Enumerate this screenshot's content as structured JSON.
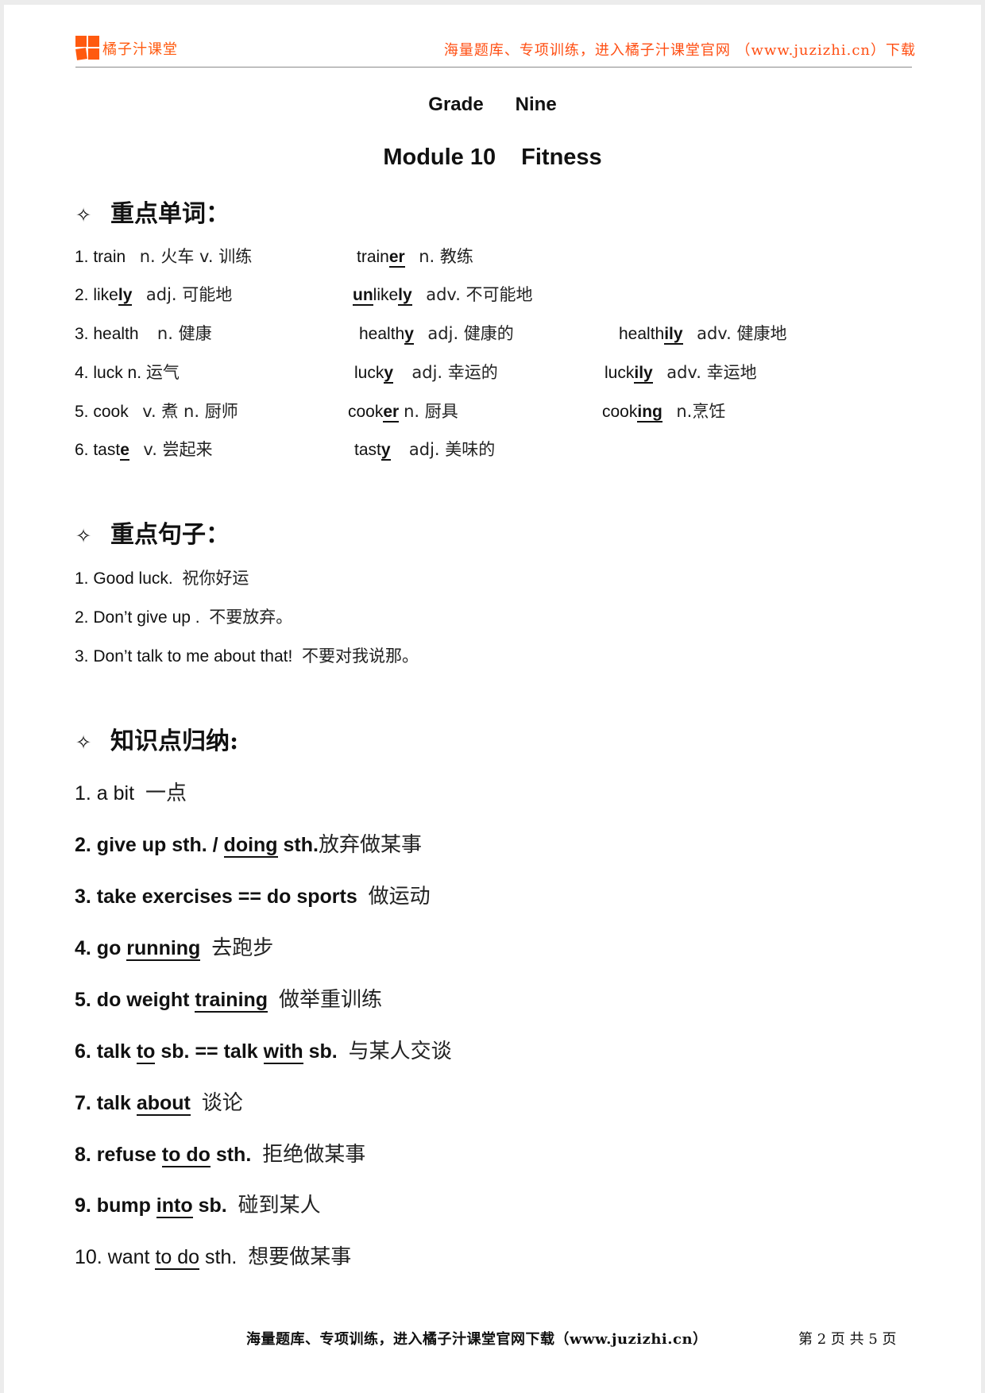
{
  "header": {
    "brand": "橘子汁课堂",
    "slogan": "海量题库、专项训练，进入橘子汁课堂官网 （www.juzizhi.cn）下载",
    "accent_color": "#ff5a0f"
  },
  "title": {
    "grade_label": "Grade",
    "grade_value": "Nine",
    "module": "Module 10",
    "topic": "Fitness"
  },
  "sections": {
    "vocab": {
      "heading": "重点单词：",
      "icon": "diamond-bullet-icon",
      "rows": [
        {
          "c1_pre": "1. train",
          "c1_ul": "",
          "c1_post": "",
          "c1_def": "n.  火车      v.  训练",
          "c2_pre": "train",
          "c2_ul": "er",
          "c2_post": "",
          "c2_def": "n.  教练",
          "c3_pre": "",
          "c3_ul": "",
          "c3_def": ""
        },
        {
          "c1_pre": "2. like",
          "c1_ul": "ly",
          "c1_post": "",
          "c1_def": "adj.  可能地",
          "c2_pre": "",
          "c2_ul": "un",
          "c2_mid": "like",
          "c2_ul2": "ly",
          "c2_def": "adv.  不可能地",
          "c3_pre": "",
          "c3_ul": "",
          "c3_def": ""
        },
        {
          "c1_pre": "3. health",
          "c1_ul": "",
          "c1_post": "",
          "c1_def": "n.  健康",
          "c2_pre": "health",
          "c2_ul": "y",
          "c2_post": "",
          "c2_def": "adj.  健康的",
          "c3_pre": "health",
          "c3_ul": "ily",
          "c3_def": "adv.    健康地"
        },
        {
          "c1_pre": "4. luck n.",
          "c1_ul": "",
          "c1_post": "",
          "c1_def": "运气",
          "c2_pre": "luck",
          "c2_ul": "y",
          "c2_post": "",
          "c2_def": "adj.  幸运的",
          "c3_pre": "luck",
          "c3_ul": "ily",
          "c3_def": "adv.  幸运地"
        },
        {
          "c1_pre": "5. cook",
          "c1_ul": "",
          "c1_post": "",
          "c1_def": "v.  煮      n.  厨师",
          "c2_pre": "cook",
          "c2_ul": "er",
          "c2_post": "",
          "c2_def": "n.  厨具",
          "c3_pre": "cook",
          "c3_ul": "ing",
          "c3_def": "n.烹饪"
        },
        {
          "c1_pre": "6. tast",
          "c1_ul": "e",
          "c1_post": "",
          "c1_def": "v.  尝起来",
          "c2_pre": "tast",
          "c2_ul": "y",
          "c2_post": "",
          "c2_def": "adj.  美味的",
          "c3_pre": "",
          "c3_ul": "",
          "c3_def": ""
        }
      ]
    },
    "sentences": {
      "heading": "重点句子：",
      "icon": "diamond-bullet-icon",
      "items": [
        {
          "en": "1. Good luck.",
          "cn": "祝你好运"
        },
        {
          "en": "2. Don’t give up .",
          "cn": "不要放弃。"
        },
        {
          "en": "3. Don’t talk to me about that!",
          "cn": "不要对我说那。"
        }
      ]
    },
    "knowledge": {
      "heading": "知识点归纳:",
      "icon": "diamond-bullet-icon",
      "items": [
        {
          "parts": [
            "1.  a bit"
          ],
          "ul": [],
          "cn": "一点"
        },
        {
          "parts": [
            "2. give up sth. / ",
            "doing",
            " sth."
          ],
          "cn": "放弃做某事"
        },
        {
          "parts": [
            "3. take exercises == do sports"
          ],
          "cn": "做运动"
        },
        {
          "parts": [
            "4. go ",
            "running",
            ""
          ],
          "cn": "去跑步"
        },
        {
          "parts": [
            "5. do weight ",
            "training",
            ""
          ],
          "cn": "做举重训练"
        },
        {
          "parts": [
            "6. talk ",
            "to",
            " sb. == talk ",
            "with",
            " sb."
          ],
          "cn": "与某人交谈"
        },
        {
          "parts": [
            "7. talk ",
            "about",
            ""
          ],
          "cn": "谈论"
        },
        {
          "parts": [
            "8. refuse ",
            "to do",
            " sth."
          ],
          "cn": "拒绝做某事"
        },
        {
          "parts": [
            "9. bump ",
            "into",
            " sb."
          ],
          "cn": "碰到某人"
        },
        {
          "parts": [
            "10. want ",
            "to do",
            " sth."
          ],
          "cn": "想要做某事"
        }
      ]
    }
  },
  "footer": {
    "text": "海量题库、专项训练，进入橘子汁课堂官网下载（www.juzizhi.cn）",
    "page_label": "第 2 页 共 5 页",
    "page_current": 2,
    "page_total": 5
  }
}
